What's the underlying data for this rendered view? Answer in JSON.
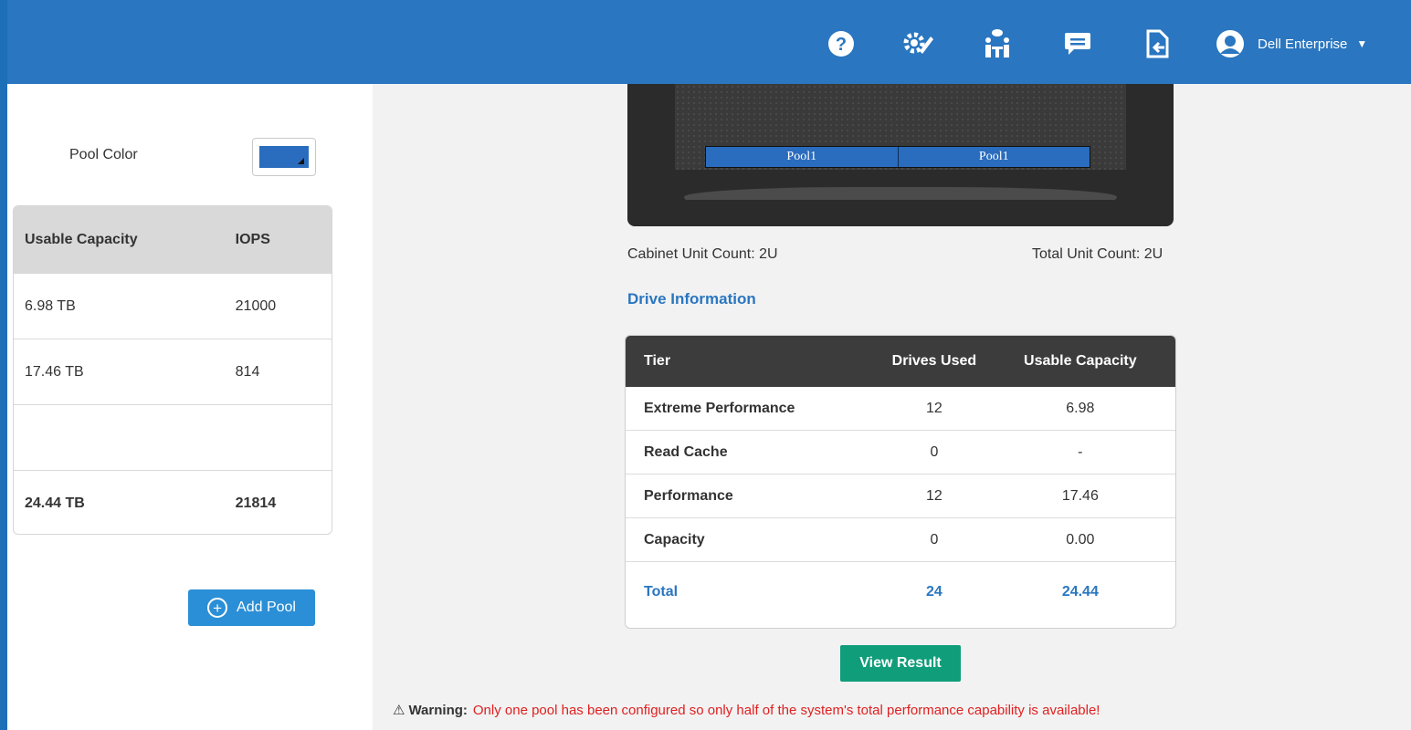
{
  "header": {
    "icons": [
      "help-icon",
      "settings-icon",
      "support-icon",
      "chat-icon",
      "export-icon"
    ],
    "user_name": "Dell Enterprise",
    "caret": "▼"
  },
  "pool_config": {
    "pool_color_label": "Pool Color",
    "pool_color": "#2a6cbe"
  },
  "capacity_table": {
    "headers": [
      "Usable Capacity",
      "IOPS"
    ],
    "rows": [
      [
        "6.98 TB",
        "21000"
      ],
      [
        "17.46 TB",
        "814"
      ],
      [
        "",
        ""
      ]
    ],
    "total": [
      "24.44 TB",
      "21814"
    ]
  },
  "add_pool_label": "Add Pool",
  "cabinet": {
    "slots": [
      "Pool1",
      "Pool1"
    ],
    "cabinet_unit_count": "Cabinet Unit Count: 2U",
    "total_unit_count": "Total Unit Count: 2U"
  },
  "drive_information": {
    "title": "Drive Information",
    "headers": [
      "Tier",
      "Drives Used",
      "Usable Capacity"
    ],
    "rows": [
      [
        "Extreme Performance",
        "12",
        "6.98"
      ],
      [
        "Read Cache",
        "0",
        "-"
      ],
      [
        "Performance",
        "12",
        "17.46"
      ],
      [
        "Capacity",
        "0",
        "0.00"
      ]
    ],
    "total": [
      "Total",
      "24",
      "24.44"
    ]
  },
  "view_result_label": "View Result",
  "warning": {
    "icon": "⚠",
    "label": "Warning:",
    "text": "Only one pool has been configured so only half of the system's total performance capability is available!"
  },
  "colors": {
    "header": "#2a76c0",
    "accent_button": "#2a8fd6",
    "primary_button": "#0f9d7a",
    "warning": "#e02020"
  }
}
